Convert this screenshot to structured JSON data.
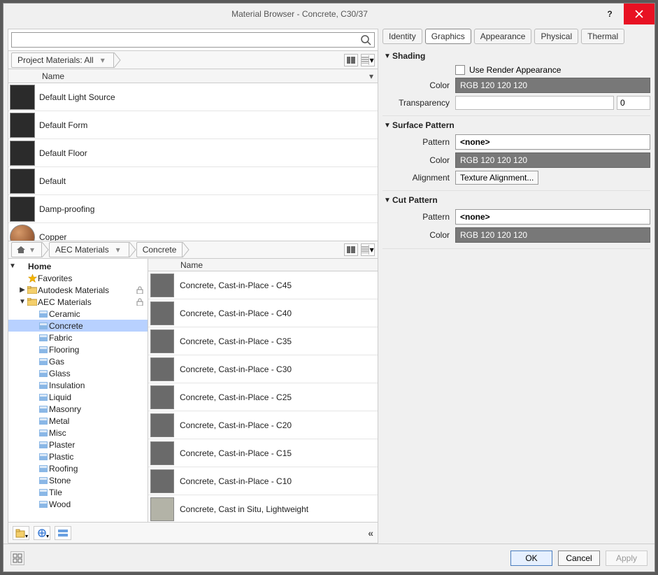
{
  "window": {
    "title": "Material Browser - Concrete, C30/37"
  },
  "search": {
    "placeholder": ""
  },
  "project_crumb": {
    "label": "Project Materials: All"
  },
  "name_header": "Name",
  "project_materials": [
    {
      "name": "Default Light Source",
      "swatch": "dark"
    },
    {
      "name": "Default Form",
      "swatch": "dark"
    },
    {
      "name": "Default Floor",
      "swatch": "dark"
    },
    {
      "name": "Default",
      "swatch": "dark"
    },
    {
      "name": "Damp-proofing",
      "swatch": "dark"
    },
    {
      "name": "Copper",
      "swatch": "copper"
    }
  ],
  "lib_crumbs": {
    "b1": "AEC Materials",
    "b2": "Concrete"
  },
  "tree": {
    "home": "Home",
    "favorites": "Favorites",
    "autodesk": "Autodesk Materials",
    "aec": "AEC Materials",
    "cats": [
      "Ceramic",
      "Concrete",
      "Fabric",
      "Flooring",
      "Gas",
      "Glass",
      "Insulation",
      "Liquid",
      "Masonry",
      "Metal",
      "Misc",
      "Plaster",
      "Plastic",
      "Roofing",
      "Stone",
      "Tile",
      "Wood"
    ]
  },
  "lib_name_header": "Name",
  "library_materials": [
    "Concrete, Cast-in-Place - C45",
    "Concrete, Cast-in-Place - C40",
    "Concrete, Cast-in-Place - C35",
    "Concrete, Cast-in-Place - C30",
    "Concrete, Cast-in-Place - C25",
    "Concrete, Cast-in-Place - C20",
    "Concrete, Cast-in-Place - C15",
    "Concrete, Cast-in-Place - C10",
    "Concrete, Cast in Situ, Lightweight"
  ],
  "tabs": {
    "identity": "Identity",
    "graphics": "Graphics",
    "appearance": "Appearance",
    "physical": "Physical",
    "thermal": "Thermal"
  },
  "shading": {
    "title": "Shading",
    "use_render": "Use Render Appearance",
    "color_label": "Color",
    "color_value": "RGB 120 120 120",
    "transp_label": "Transparency",
    "transp_value": "0"
  },
  "surface": {
    "title": "Surface Pattern",
    "pattern_label": "Pattern",
    "pattern_value": "<none>",
    "color_label": "Color",
    "color_value": "RGB 120 120 120",
    "align_label": "Alignment",
    "align_btn": "Texture Alignment..."
  },
  "cut": {
    "title": "Cut Pattern",
    "pattern_label": "Pattern",
    "pattern_value": "<none>",
    "color_label": "Color",
    "color_value": "RGB 120 120 120"
  },
  "footer": {
    "ok": "OK",
    "cancel": "Cancel",
    "apply": "Apply"
  }
}
